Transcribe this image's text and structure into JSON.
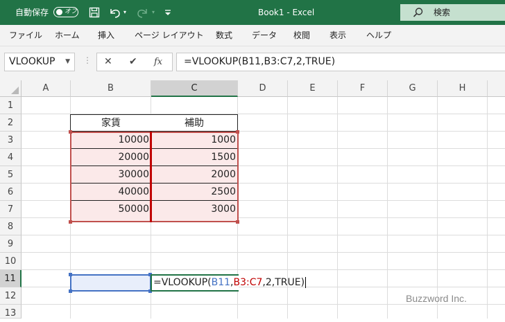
{
  "titlebar": {
    "autosave_label": "自動保存",
    "toggle_label": "オフ",
    "doc_title": "Book1  -  Excel",
    "search_placeholder": "検索"
  },
  "menu": [
    "ファイル",
    "ホーム",
    "挿入",
    "ページ レイアウト",
    "数式",
    "データ",
    "校閲",
    "表示",
    "ヘルプ"
  ],
  "formula_bar": {
    "name_box": "VLOOKUP",
    "formula": "=VLOOKUP(B11,B3:C7,2,TRUE)"
  },
  "grid": {
    "columns": [
      "A",
      "B",
      "C",
      "D",
      "E",
      "F",
      "G",
      "H"
    ],
    "rows": [
      "1",
      "2",
      "3",
      "4",
      "5",
      "6",
      "7",
      "8",
      "9",
      "10",
      "11",
      "12",
      "13"
    ],
    "selected_column": "C",
    "selected_row": "11",
    "table_header": {
      "b": "家賃",
      "c": "補助"
    },
    "table_rows": [
      {
        "b": "10000",
        "c": "1000"
      },
      {
        "b": "20000",
        "c": "1500"
      },
      {
        "b": "30000",
        "c": "2000"
      },
      {
        "b": "40000",
        "c": "2500"
      },
      {
        "b": "50000",
        "c": "3000"
      }
    ],
    "editing_formula": {
      "prefix": "=VLOOKUP(",
      "arg1": "B11",
      "sep1": ",",
      "arg2": "B3:C7",
      "rest": ",2,TRUE)"
    }
  },
  "colors": {
    "excel_green": "#217346",
    "ref_blue": "#4472c4",
    "ref_red": "#c00000",
    "range_fill": "#fbe9e9"
  },
  "watermark": "Buzzword Inc."
}
